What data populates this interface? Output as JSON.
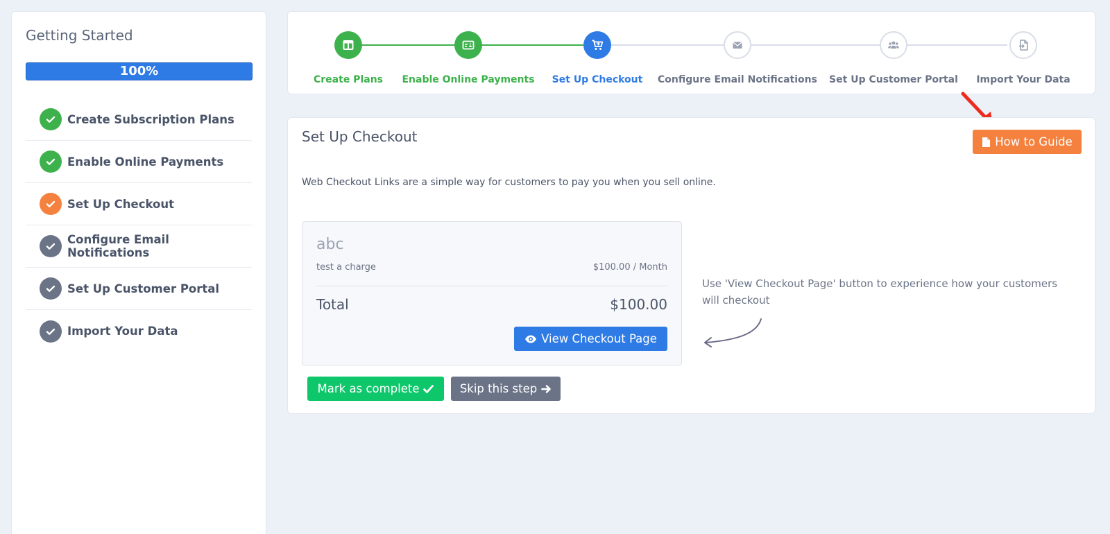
{
  "sidebar": {
    "title": "Getting Started",
    "progress": "100%",
    "progress_value": 1.0,
    "items": [
      {
        "label": "Create Subscription Plans",
        "status": "complete",
        "color": "#3db14c"
      },
      {
        "label": "Enable Online Payments",
        "status": "complete",
        "color": "#3db14c"
      },
      {
        "label": "Set Up Checkout",
        "status": "current",
        "color": "#f5813f"
      },
      {
        "label": "Configure Email Notifications",
        "status": "pending",
        "color": "#6b7487"
      },
      {
        "label": "Set Up Customer Portal",
        "status": "pending",
        "color": "#6b7487"
      },
      {
        "label": "Import Your Data",
        "status": "pending",
        "color": "#6b7487"
      }
    ]
  },
  "stepper": {
    "steps": [
      {
        "label": "Create Plans",
        "icon": "columns-icon",
        "state": "complete"
      },
      {
        "label": "Enable Online Payments",
        "icon": "credit-card-icon",
        "state": "complete"
      },
      {
        "label": "Set Up Checkout",
        "icon": "cart-icon",
        "state": "current"
      },
      {
        "label": "Configure Email Notifications",
        "icon": "envelope-icon",
        "state": "pending"
      },
      {
        "label": "Set Up Customer Portal",
        "icon": "users-icon",
        "state": "pending"
      },
      {
        "label": "Import Your Data",
        "icon": "file-import-icon",
        "state": "pending"
      }
    ]
  },
  "main": {
    "title": "Set Up Checkout",
    "guide_button": "How to Guide",
    "description": "Web Checkout Links are a simple way for customers to pay you when you sell online.",
    "checkout": {
      "name": "abc",
      "item": "test a charge",
      "price": "$100.00 / Month",
      "total_label": "Total",
      "total": "$100.00",
      "view_button": "View Checkout Page"
    },
    "mark_button": "Mark as complete",
    "skip_button": "Skip this step",
    "hint": "Use 'View Checkout Page' button to experience how your customers will checkout"
  },
  "colors": {
    "accent": "#2f7be5",
    "complete": "#3db14c",
    "current": "#f5813f",
    "pending": "#6b7487",
    "mark_complete": "#0ec76b",
    "annotation_arrow": "#ee2a1c"
  }
}
